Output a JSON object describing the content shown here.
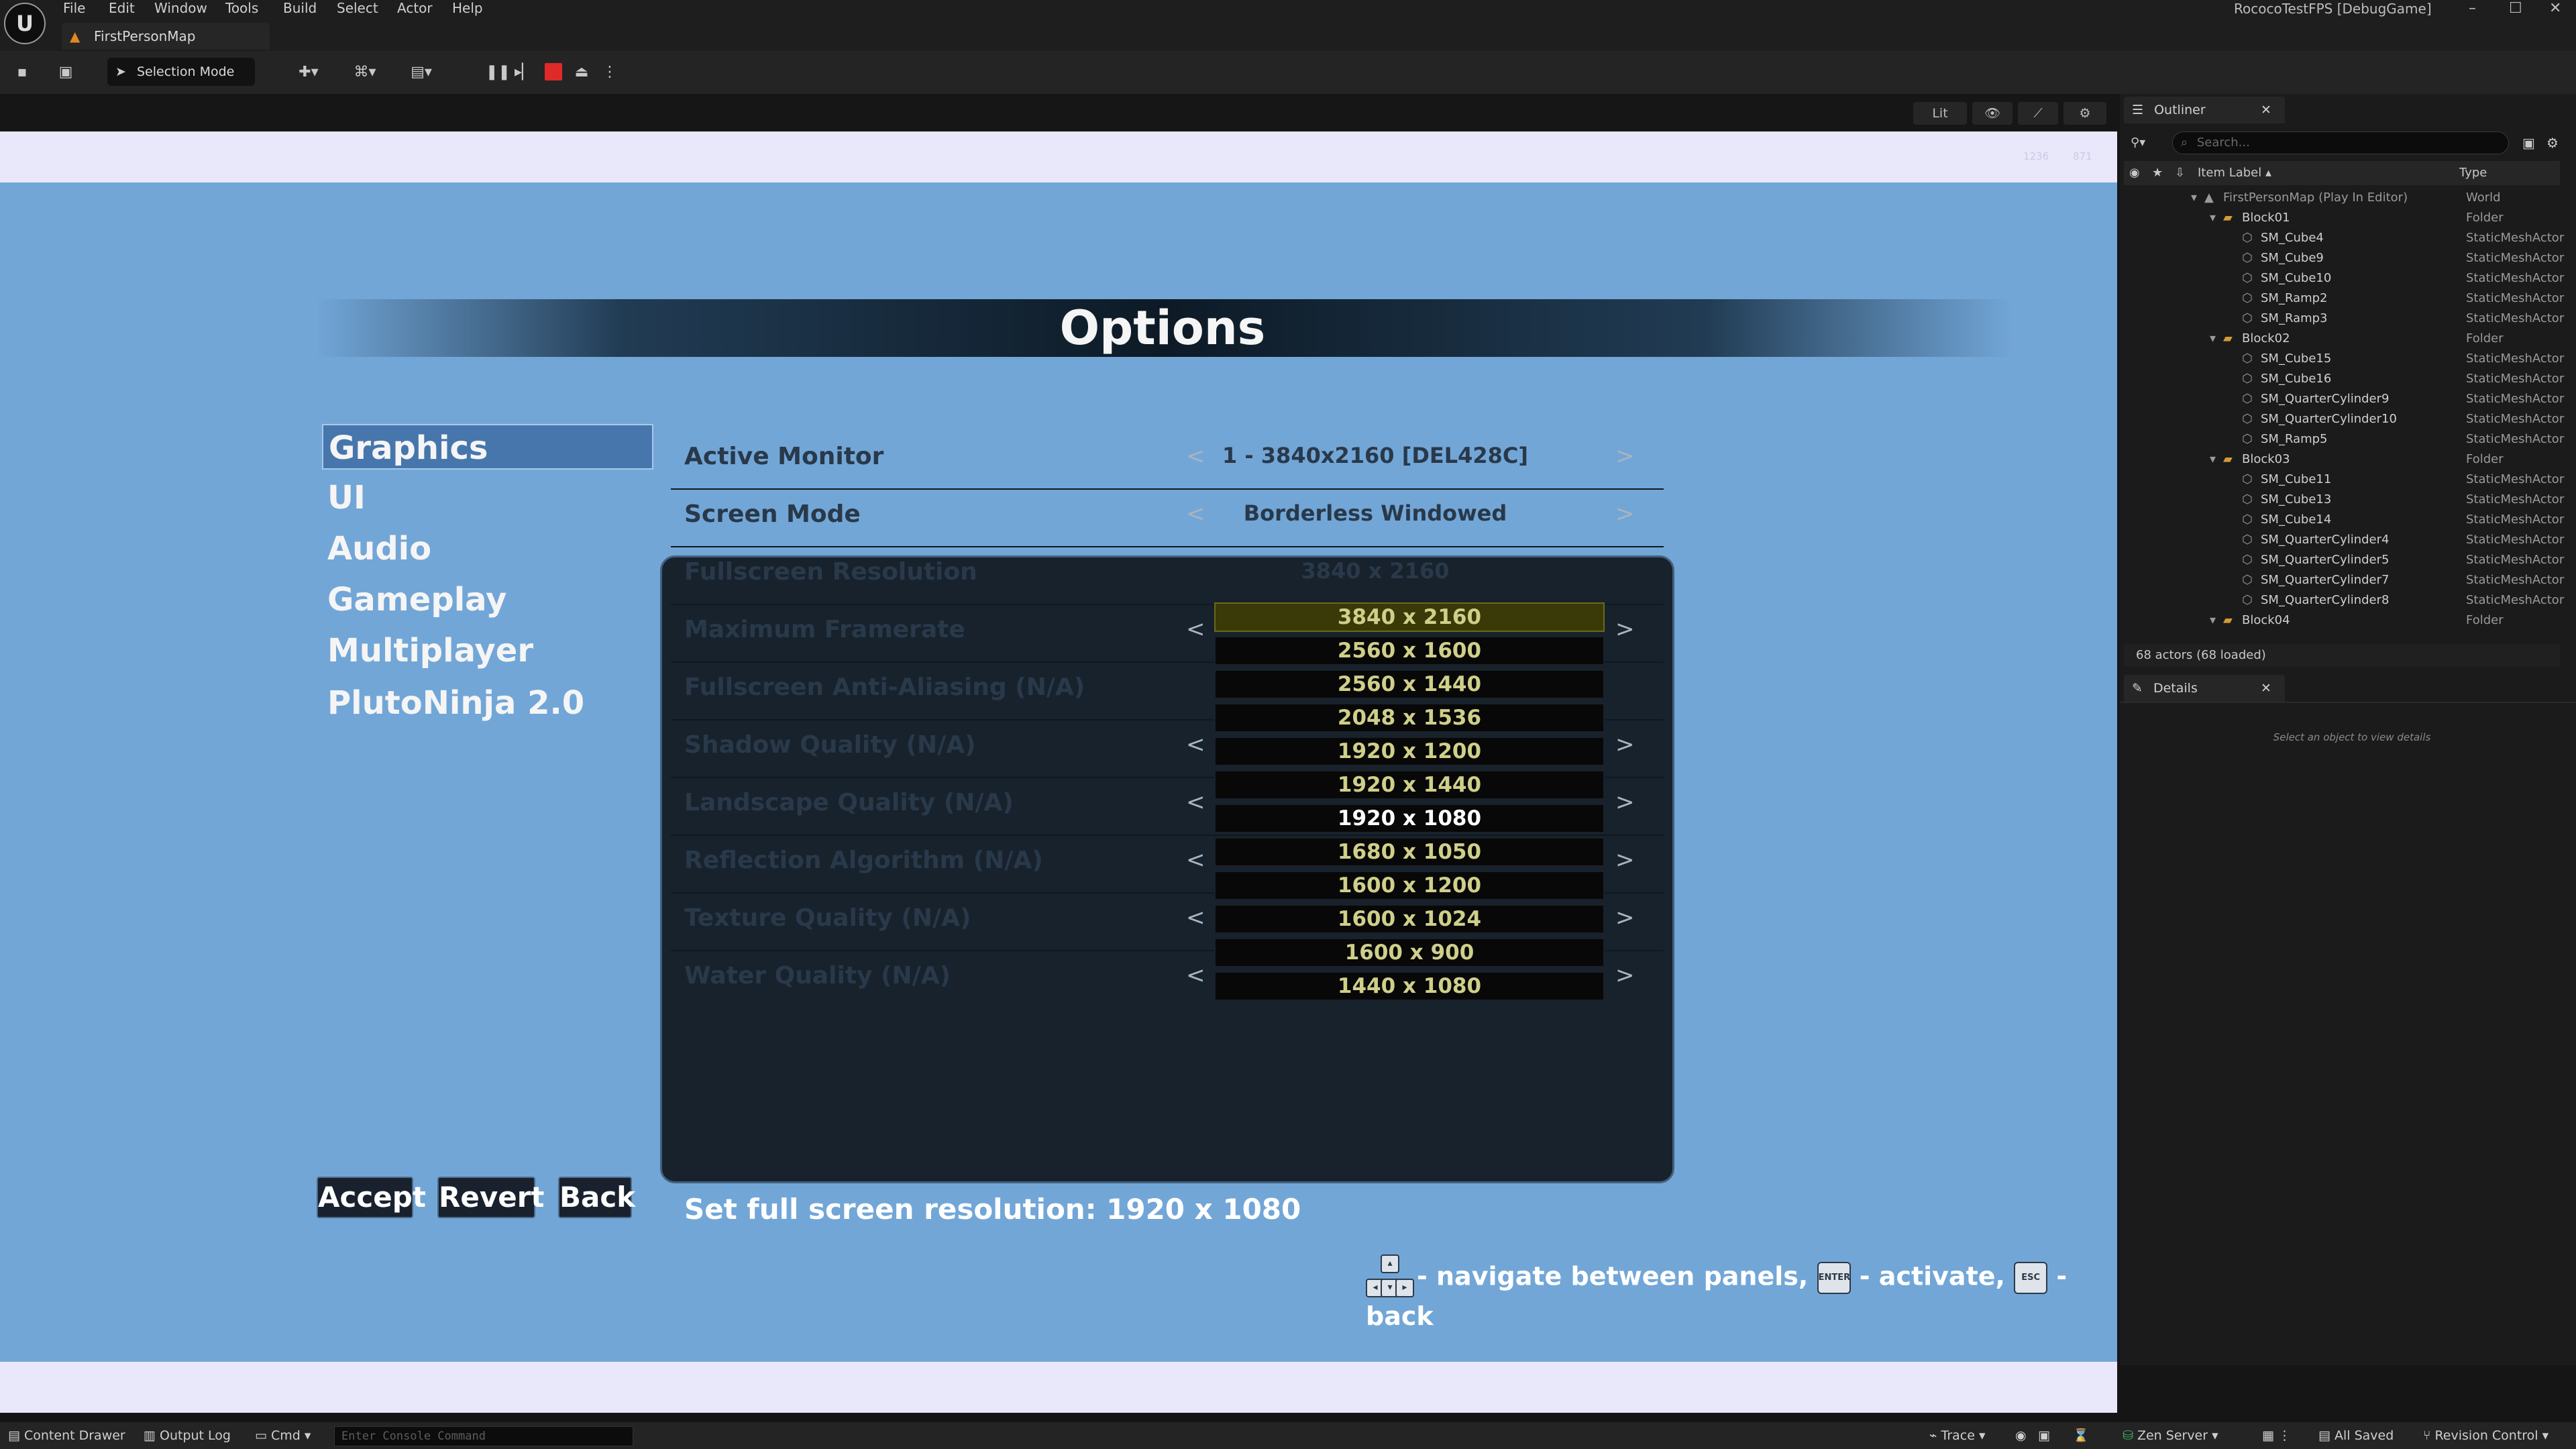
{
  "app": {
    "window_title": "RococoTestFPS [DebugGame]",
    "map_tab": "FirstPersonMap",
    "menu": [
      "File",
      "Edit",
      "Window",
      "Tools",
      "Build",
      "Select",
      "Actor",
      "Help"
    ],
    "window_controls": [
      "–",
      "☐",
      "✕"
    ]
  },
  "toolbar": {
    "selection_mode": "Selection Mode",
    "viewport_buttons": [
      "Lit",
      "👁",
      "⟋",
      "⚙"
    ]
  },
  "viewport": {
    "stats": [
      "1236",
      "871"
    ],
    "title": "Options",
    "categories": [
      {
        "label": "Graphics",
        "selected": true
      },
      {
        "label": "UI",
        "selected": false
      },
      {
        "label": "Audio",
        "selected": false
      },
      {
        "label": "Gameplay",
        "selected": false
      },
      {
        "label": "Multiplayer",
        "selected": false
      },
      {
        "label": "PlutoNinja 2.0",
        "selected": false
      }
    ],
    "settings": [
      {
        "label": "Active Monitor",
        "value": "1 - 3840x2160 [DEL428C]",
        "arrows": true
      },
      {
        "label": "Screen Mode",
        "value": "Borderless Windowed",
        "arrows": true
      },
      {
        "label": "Fullscreen Resolution",
        "value": "3840 x 2160",
        "arrows": false
      },
      {
        "label": "Maximum Framerate",
        "value": "",
        "arrows": true
      },
      {
        "label": "Fullscreen Anti-Aliasing (N/A)",
        "value": "",
        "arrows": false
      },
      {
        "label": "Shadow Quality (N/A)",
        "value": "",
        "arrows": true
      },
      {
        "label": "Landscape Quality (N/A)",
        "value": "",
        "arrows": true
      },
      {
        "label": "Reflection Algorithm (N/A)",
        "value": "",
        "arrows": true
      },
      {
        "label": "Texture Quality (N/A)",
        "value": "",
        "arrows": true
      },
      {
        "label": "Water Quality (N/A)",
        "value": "",
        "arrows": true
      }
    ],
    "arrow_left": "<",
    "arrow_right": ">",
    "resolution_options": [
      {
        "label": "3840 x 2160",
        "highlighted": true,
        "current": false
      },
      {
        "label": "2560 x 1600",
        "highlighted": false,
        "current": false
      },
      {
        "label": "2560 x 1440",
        "highlighted": false,
        "current": false
      },
      {
        "label": "2048 x 1536",
        "highlighted": false,
        "current": false
      },
      {
        "label": "1920 x 1200",
        "highlighted": false,
        "current": false
      },
      {
        "label": "1920 x 1440",
        "highlighted": false,
        "current": false
      },
      {
        "label": "1920 x 1080",
        "highlighted": false,
        "current": true
      },
      {
        "label": "1680 x 1050",
        "highlighted": false,
        "current": false
      },
      {
        "label": "1600 x 1200",
        "highlighted": false,
        "current": false
      },
      {
        "label": "1600 x 1024",
        "highlighted": false,
        "current": false
      },
      {
        "label": "1600 x 900",
        "highlighted": false,
        "current": false
      },
      {
        "label": "1440 x 1080",
        "highlighted": false,
        "current": false
      }
    ],
    "buttons": {
      "accept": "Accept",
      "revert": "Revert",
      "back": "Back"
    },
    "description": "Set full screen resolution: 1920 x 1080",
    "hint": {
      "navigate": "- navigate between panels,",
      "activate": "- activate,",
      "back": "- back",
      "enter_key": "ENTER",
      "esc_key": "ESC"
    }
  },
  "outliner": {
    "tab": "Outliner",
    "search_placeholder": "Search...",
    "col_label": "Item Label ▴",
    "col_type": "Type",
    "rows": [
      {
        "label": "FirstPersonMap (Play In Editor)",
        "type": "World",
        "depth": 0,
        "kind": "world"
      },
      {
        "label": "Block01",
        "type": "Folder",
        "depth": 1,
        "kind": "folder"
      },
      {
        "label": "SM_Cube4",
        "type": "StaticMeshActor",
        "depth": 2,
        "kind": "actor"
      },
      {
        "label": "SM_Cube9",
        "type": "StaticMeshActor",
        "depth": 2,
        "kind": "actor"
      },
      {
        "label": "SM_Cube10",
        "type": "StaticMeshActor",
        "depth": 2,
        "kind": "actor"
      },
      {
        "label": "SM_Ramp2",
        "type": "StaticMeshActor",
        "depth": 2,
        "kind": "actor"
      },
      {
        "label": "SM_Ramp3",
        "type": "StaticMeshActor",
        "depth": 2,
        "kind": "actor"
      },
      {
        "label": "Block02",
        "type": "Folder",
        "depth": 1,
        "kind": "folder"
      },
      {
        "label": "SM_Cube15",
        "type": "StaticMeshActor",
        "depth": 2,
        "kind": "actor"
      },
      {
        "label": "SM_Cube16",
        "type": "StaticMeshActor",
        "depth": 2,
        "kind": "actor"
      },
      {
        "label": "SM_QuarterCylinder9",
        "type": "StaticMeshActor",
        "depth": 2,
        "kind": "actor"
      },
      {
        "label": "SM_QuarterCylinder10",
        "type": "StaticMeshActor",
        "depth": 2,
        "kind": "actor"
      },
      {
        "label": "SM_Ramp5",
        "type": "StaticMeshActor",
        "depth": 2,
        "kind": "actor"
      },
      {
        "label": "Block03",
        "type": "Folder",
        "depth": 1,
        "kind": "folder"
      },
      {
        "label": "SM_Cube11",
        "type": "StaticMeshActor",
        "depth": 2,
        "kind": "actor"
      },
      {
        "label": "SM_Cube13",
        "type": "StaticMeshActor",
        "depth": 2,
        "kind": "actor"
      },
      {
        "label": "SM_Cube14",
        "type": "StaticMeshActor",
        "depth": 2,
        "kind": "actor"
      },
      {
        "label": "SM_QuarterCylinder4",
        "type": "StaticMeshActor",
        "depth": 2,
        "kind": "actor"
      },
      {
        "label": "SM_QuarterCylinder5",
        "type": "StaticMeshActor",
        "depth": 2,
        "kind": "actor"
      },
      {
        "label": "SM_QuarterCylinder7",
        "type": "StaticMeshActor",
        "depth": 2,
        "kind": "actor"
      },
      {
        "label": "SM_QuarterCylinder8",
        "type": "StaticMeshActor",
        "depth": 2,
        "kind": "actor"
      },
      {
        "label": "Block04",
        "type": "Folder",
        "depth": 1,
        "kind": "folder"
      }
    ],
    "footer": "68 actors (68 loaded)"
  },
  "details": {
    "tab": "Details",
    "empty": "Select an object to view details"
  },
  "statusbar": {
    "content_drawer": "Content Drawer",
    "output_log": "Output Log",
    "cmd": "Cmd",
    "console_placeholder": "Enter Console Command",
    "trace": "Trace",
    "zen_server": "Zen Server",
    "all_saved": "All Saved",
    "revision_control": "Revision Control"
  },
  "colors": {
    "viewport_bg": "#72a6d7",
    "panel_bg": "#17222d",
    "selected_category": "#4776ad",
    "option_text": "#cfcf8a",
    "stop_button": "#e02a2a"
  }
}
